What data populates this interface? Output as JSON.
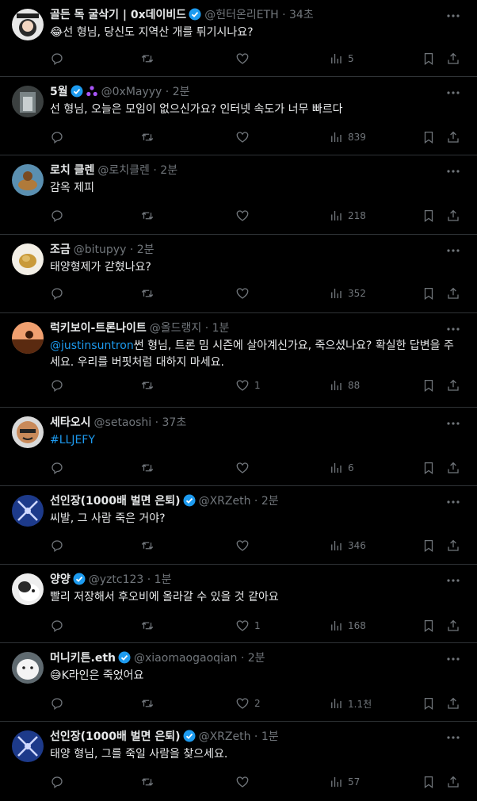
{
  "accent": "#1d9bf0",
  "muted": "#71767b",
  "posts": [
    {
      "name": "골든 독 굴삭기 | 0x데이비드",
      "verified": true,
      "purple_badge": false,
      "handle": "@헌터온리ETH",
      "dot": "·",
      "time": "34초",
      "emoji": "😂",
      "mention": "",
      "text": "선 형님, 당신도 지역산 개를 튀기시나요?",
      "replies": "",
      "retweets": "",
      "likes": "",
      "views": "5"
    },
    {
      "name": "5월",
      "verified": true,
      "purple_badge": true,
      "handle": "@0xMayyy",
      "dot": "·",
      "time": "2분",
      "emoji": "",
      "mention": "",
      "text": "선 형님, 오늘은 모임이 없으신가요? 인터넷 속도가 너무 빠르다",
      "replies": "",
      "retweets": "",
      "likes": "",
      "views": "839"
    },
    {
      "name": "로치 클렌",
      "verified": false,
      "purple_badge": false,
      "handle": "@로치클렌",
      "dot": "·",
      "time": "2분",
      "emoji": "",
      "mention": "",
      "text": "감옥 제피",
      "replies": "",
      "retweets": "",
      "likes": "",
      "views": "218"
    },
    {
      "name": "조금",
      "verified": false,
      "purple_badge": false,
      "handle": "@bitupyy",
      "dot": "·",
      "time": "2분",
      "emoji": "",
      "mention": "",
      "text": "태양형제가 갇혔나요?",
      "replies": "",
      "retweets": "",
      "likes": "",
      "views": "352"
    },
    {
      "name": "럭키보이-트론나이트",
      "verified": false,
      "purple_badge": false,
      "handle": "@올드랭지",
      "dot": "·",
      "time": "1분",
      "emoji": "",
      "mention": "@justinsuntron",
      "text": "썬 형님, 트론 밈 시즌에 살아계신가요, 죽으셨나요? 확실한 답변을 주세요. 우리를 버핏처럼 대하지 마세요.",
      "replies": "",
      "retweets": "",
      "likes": "1",
      "views": "88"
    },
    {
      "name": "세타오시",
      "verified": false,
      "purple_badge": false,
      "handle": "@setaoshi",
      "dot": "·",
      "time": "37초",
      "emoji": "",
      "mention": "",
      "hashtag": "#LLJEFY",
      "text": "",
      "replies": "",
      "retweets": "",
      "likes": "",
      "views": "6"
    },
    {
      "name": "선인장(1000배 벌면 은퇴)",
      "verified": true,
      "purple_badge": false,
      "handle": "@XRZeth",
      "dot": "·",
      "time": "2분",
      "emoji": "",
      "mention": "",
      "text": "씨발, 그 사람 죽은 거야?",
      "replies": "",
      "retweets": "",
      "likes": "",
      "views": "346"
    },
    {
      "name": "양양",
      "verified": true,
      "purple_badge": false,
      "handle": "@yztc123",
      "dot": "·",
      "time": "1분",
      "emoji": "",
      "mention": "",
      "text": "빨리 저장해서 후오비에 올라갈 수 있을 것 같아요",
      "replies": "",
      "retweets": "",
      "likes": "1",
      "views": "168"
    },
    {
      "name": "머니키튼.eth",
      "verified": true,
      "purple_badge": false,
      "handle": "@xiaomaogaoqian",
      "dot": "·",
      "time": "2분",
      "emoji": "😅",
      "mention": "",
      "text": "K라인은 죽었어요",
      "replies": "",
      "retweets": "",
      "likes": "2",
      "views": "1.1천"
    },
    {
      "name": "선인장(1000배 벌면 은퇴)",
      "verified": true,
      "purple_badge": false,
      "handle": "@XRZeth",
      "dot": "·",
      "time": "1분",
      "emoji": "",
      "mention": "",
      "text": "태양 형님, 그를 죽일 사람을 찾으세요.",
      "replies": "",
      "retweets": "",
      "likes": "",
      "views": "57"
    }
  ]
}
